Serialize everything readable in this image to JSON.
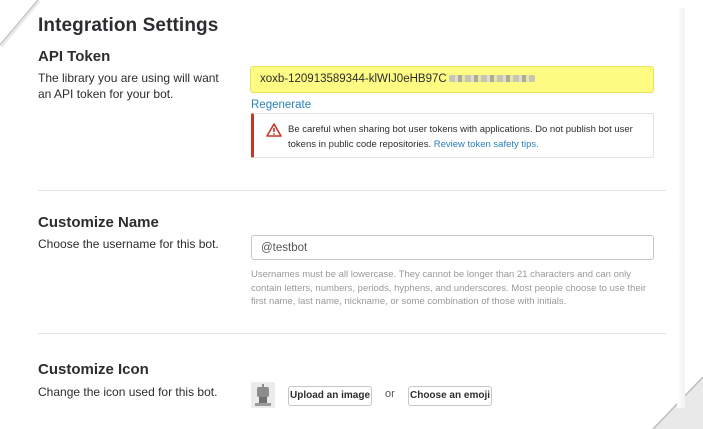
{
  "page": {
    "title": "Integration Settings"
  },
  "api_token": {
    "title": "API Token",
    "description": "The library you are using will want an API token for your bot.",
    "token_value": "xoxb-120913589344-klWIJ0eHB97C",
    "regenerate_label": "Regenerate",
    "warning_text": "Be careful when sharing bot user tokens with applications. Do not publish bot user tokens in public code repositories. ",
    "warning_link": "Review token safety tips."
  },
  "customize_name": {
    "title": "Customize Name",
    "description": "Choose the username for this bot.",
    "username_value": "@testbot",
    "hint": "Usernames must be all lowercase. They cannot be longer than 21 characters and can only contain letters, numbers, periods, hyphens, and underscores. Most people choose to use their first name, last name, nickname, or some combination of those with initials."
  },
  "customize_icon": {
    "title": "Customize Icon",
    "description": "Change the icon used for this bot.",
    "upload_label": "Upload an image",
    "or_label": "or",
    "emoji_label": "Choose an emoji"
  },
  "colors": {
    "token_highlight": "#fdfb82",
    "link": "#2a80b9",
    "warning_accent": "#c0392b"
  },
  "icons": [
    "warning-icon",
    "bot-avatar-icon"
  ]
}
